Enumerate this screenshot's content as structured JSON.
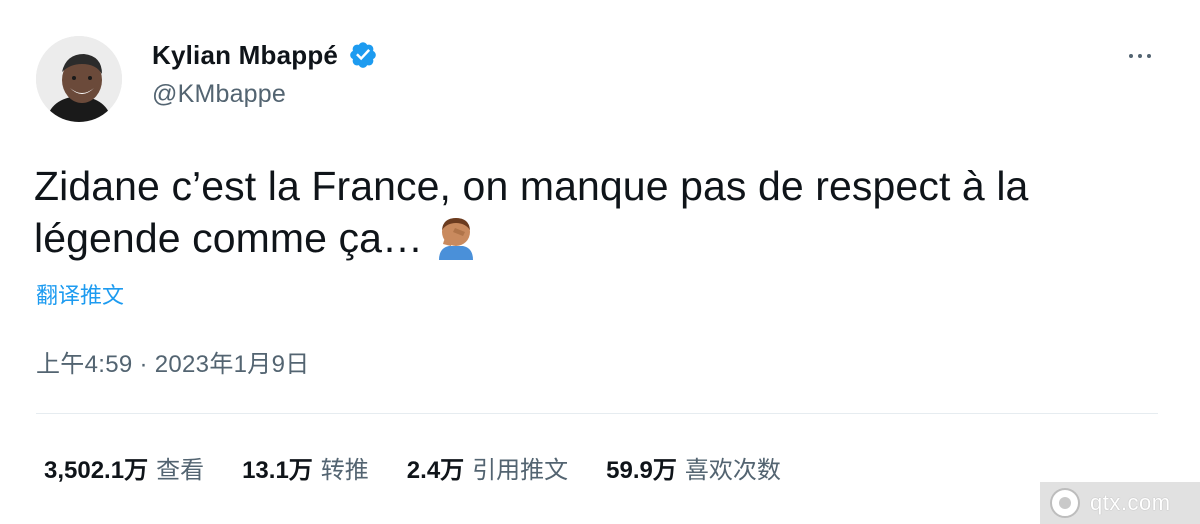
{
  "author": {
    "display_name": "Kylian Mbappé",
    "handle": "@KMbappe",
    "verified": true
  },
  "tweet": {
    "text": "Zidane c’est la France, on manque pas de respect à la légende comme ça…",
    "emoji": "facepalm-emoji",
    "translate_label": "翻译推文",
    "timestamp": "上午4:59 · 2023年1月9日"
  },
  "stats": {
    "views": {
      "count": "3,502.1万",
      "label": "查看"
    },
    "retweets": {
      "count": "13.1万",
      "label": "转推"
    },
    "quotes": {
      "count": "2.4万",
      "label": "引用推文"
    },
    "likes": {
      "count": "59.9万",
      "label": "喜欢次数"
    }
  },
  "watermark": {
    "text": "qtx.com"
  },
  "colors": {
    "accent": "#1d9bf0",
    "secondary_text": "#536471",
    "primary_text": "#0f1419"
  }
}
